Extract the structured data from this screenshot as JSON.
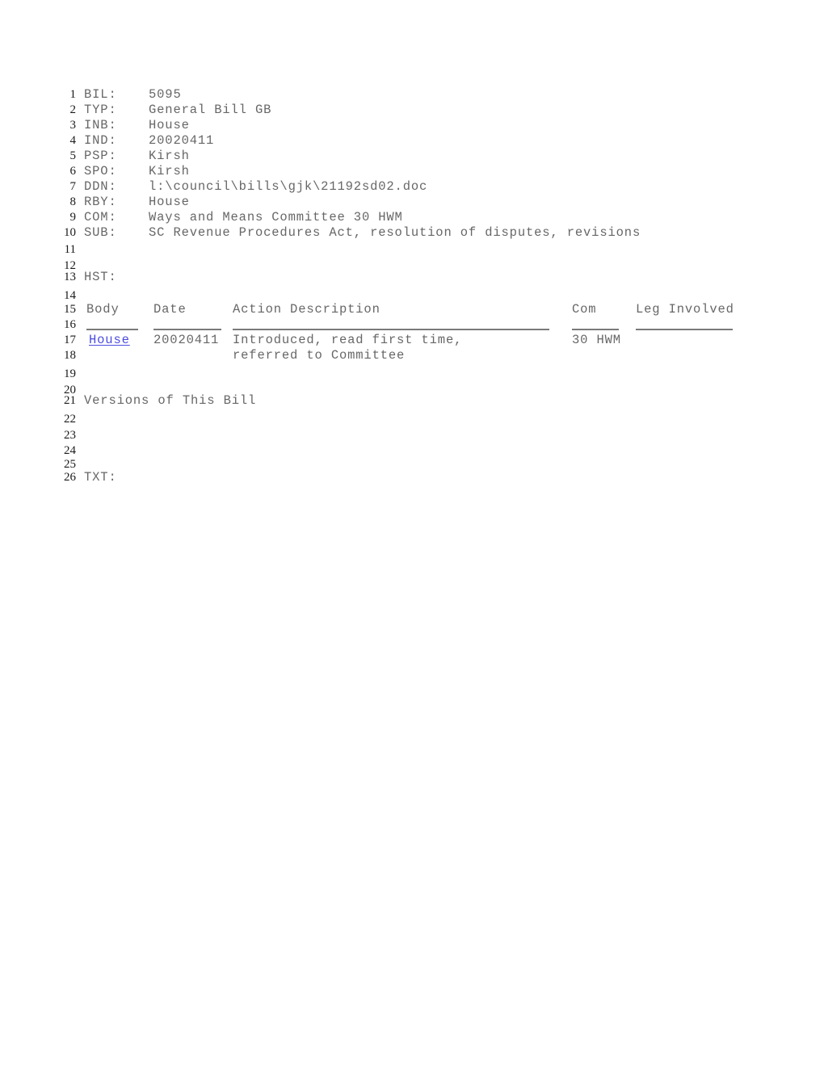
{
  "document": {
    "type": "legislative-bill-record",
    "link_color": "#4c4ce0",
    "text_color": "#676767",
    "lineno_color": "#1a1a1a"
  },
  "fields": [
    {
      "line": "1",
      "label": "BIL:",
      "value": "5095"
    },
    {
      "line": "2",
      "label": "TYP:",
      "value": "General Bill GB"
    },
    {
      "line": "3",
      "label": "INB:",
      "value": "House"
    },
    {
      "line": "4",
      "label": "IND:",
      "value": "20020411"
    },
    {
      "line": "5",
      "label": "PSP:",
      "value": "Kirsh"
    },
    {
      "line": "6",
      "label": "SPO:",
      "value": "Kirsh"
    },
    {
      "line": "7",
      "label": "DDN:",
      "value": "l:\\council\\bills\\gjk\\21192sd02.doc"
    },
    {
      "line": "8",
      "label": "RBY:",
      "value": "House"
    },
    {
      "line": "9",
      "label": "COM:",
      "value": "Ways and Means Committee 30 HWM"
    },
    {
      "line": "10",
      "label": "SUB:",
      "value": "SC Revenue Procedures Act, resolution of disputes, revisions"
    }
  ],
  "blank_lines": [
    "11",
    "12",
    "14",
    "16",
    "18",
    "19",
    "20",
    "22",
    "23",
    "24",
    "25"
  ],
  "history": {
    "line_label": "13",
    "label": "HST:",
    "header_line": "15",
    "rule_line": "16",
    "columns": [
      "Body",
      "Date",
      "Action Description",
      "Com",
      "Leg Involved"
    ],
    "rows": [
      {
        "line": "17",
        "continuation_line": "18",
        "body": "House",
        "body_is_link": true,
        "date": "20020411",
        "action": "Introduced, read first time,",
        "action_continued": "referred to Committee",
        "com": "30 HWM",
        "leg_involved": ""
      }
    ]
  },
  "versions": {
    "line": "21",
    "label": "Versions of This Bill"
  },
  "text_section": {
    "line": "26",
    "label": "TXT:"
  }
}
